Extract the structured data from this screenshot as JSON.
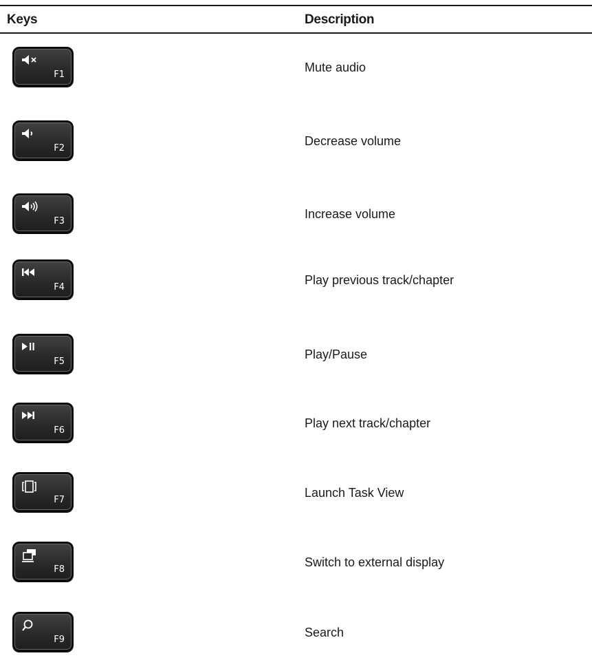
{
  "table": {
    "headers": {
      "keys": "Keys",
      "description": "Description"
    },
    "rows": [
      {
        "key": "F1",
        "icon": "mute-audio-icon",
        "description": "Mute audio"
      },
      {
        "key": "F2",
        "icon": "volume-down-icon",
        "description": "Decrease volume"
      },
      {
        "key": "F3",
        "icon": "volume-up-icon",
        "description": "Increase volume"
      },
      {
        "key": "F4",
        "icon": "previous-track-icon",
        "description": "Play previous track/chapter"
      },
      {
        "key": "F5",
        "icon": "play-pause-icon",
        "description": "Play/Pause"
      },
      {
        "key": "F6",
        "icon": "next-track-icon",
        "description": "Play next track/chapter"
      },
      {
        "key": "F7",
        "icon": "task-view-icon",
        "description": "Launch Task View"
      },
      {
        "key": "F8",
        "icon": "external-display-icon",
        "description": "Switch to external display"
      },
      {
        "key": "F9",
        "icon": "search-icon",
        "description": "Search"
      }
    ]
  },
  "colors": {
    "text": "#1a1a1a",
    "key_face": "#2a2a2a",
    "key_glyph": "#ffffff"
  }
}
